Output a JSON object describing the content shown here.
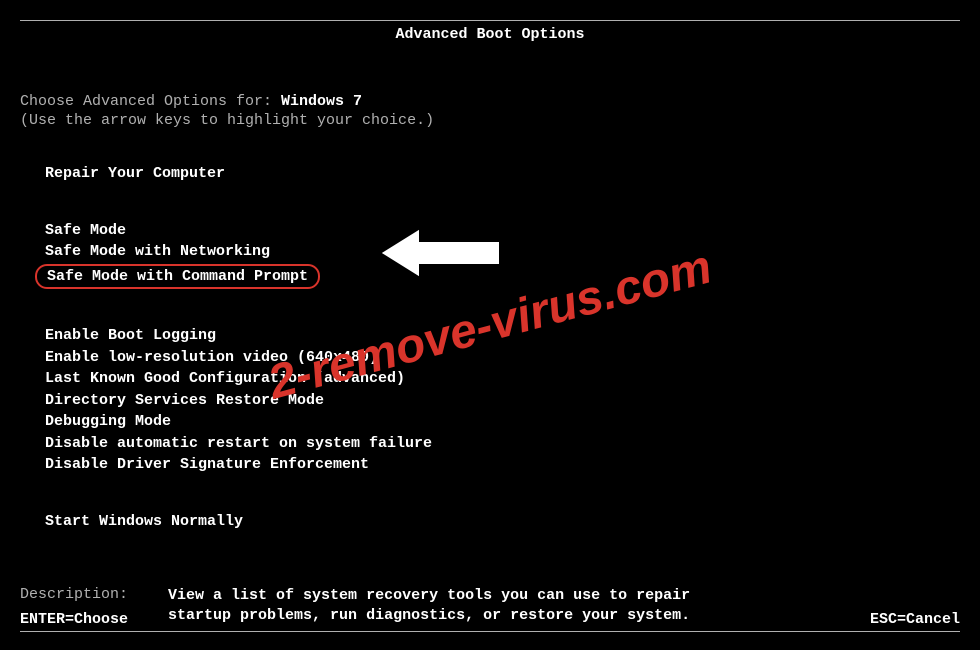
{
  "title": "Advanced Boot Options",
  "prompt": {
    "prefix": "Choose Advanced Options for: ",
    "os_name": "Windows 7"
  },
  "instruction": "(Use the arrow keys to highlight your choice.)",
  "menu": {
    "group1": [
      "Repair Your Computer"
    ],
    "group2": [
      "Safe Mode",
      "Safe Mode with Networking",
      "Safe Mode with Command Prompt"
    ],
    "group3": [
      "Enable Boot Logging",
      "Enable low-resolution video (640x480)",
      "Last Known Good Configuration (advanced)",
      "Directory Services Restore Mode",
      "Debugging Mode",
      "Disable automatic restart on system failure",
      "Disable Driver Signature Enforcement"
    ],
    "group4": [
      "Start Windows Normally"
    ]
  },
  "description": {
    "label": "Description:",
    "text_line1": "View a list of system recovery tools you can use to repair",
    "text_line2": "startup problems, run diagnostics, or restore your system."
  },
  "footer": {
    "left": "ENTER=Choose",
    "right": "ESC=Cancel"
  },
  "watermark": "2-remove-virus.com",
  "highlighted_index": 2
}
